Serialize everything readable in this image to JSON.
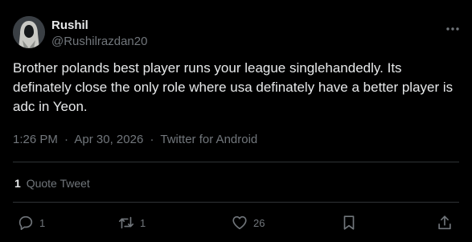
{
  "author": {
    "display_name": "Rushil",
    "handle": "@Rushilrazdan20",
    "avatar_icon": "hooded-figure-avatar"
  },
  "tweet": {
    "text": "Brother polands best player runs your league singlehandedly. Its definately close the only role where usa definately have a better player is adc in Yeon."
  },
  "meta": {
    "time": "1:26 PM",
    "separator": "·",
    "date": "Apr 30, 2026",
    "source": "Twitter for Android"
  },
  "stats": {
    "quote_count": "1",
    "quote_label": "Quote Tweet"
  },
  "actions": {
    "reply_count": "1",
    "retweet_count": "1",
    "like_count": "26"
  },
  "colors": {
    "background": "#000000",
    "primary_text": "#e7e9ea",
    "secondary_text": "#71767b",
    "divider": "#2f3336"
  }
}
